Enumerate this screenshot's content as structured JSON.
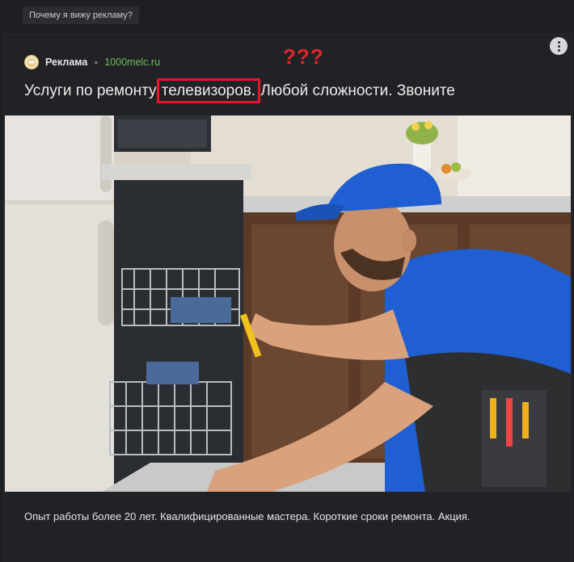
{
  "why_ad_button": "Почему я вижу рекламу?",
  "ad": {
    "label": "Реклама",
    "separator": "•",
    "domain": "1000melc.ru",
    "annotation": "???",
    "title_before": "Услуги по ремонту ",
    "title_highlight": "телевизоров.",
    "title_after": " Любой сложности. Звоните",
    "description": "Опыт работы более 20 лет. Квалифицированные мастера. Короткие сроки ремонта. Акция.",
    "image_icon": "repairman-dishwasher-photo"
  },
  "colors": {
    "background": "#1e1f22",
    "domain_green": "#6fbf5a",
    "annotation_red": "#e0262b",
    "highlight_box": "#e5162a"
  }
}
